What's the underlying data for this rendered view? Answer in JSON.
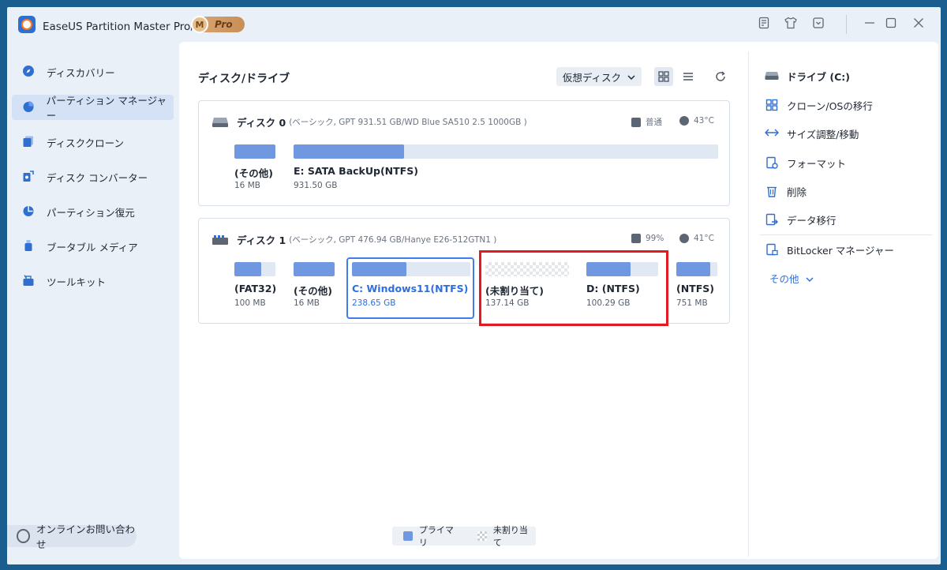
{
  "titlebar": {
    "title": "EaseUS Partition Master Pro版",
    "badge_letter": "M",
    "badge_text": "Pro",
    "icons": [
      "notes-icon",
      "shirt-icon",
      "download-icon",
      "minimize-icon",
      "maximize-icon",
      "close-icon"
    ]
  },
  "sidebar": {
    "items": [
      {
        "label": "ディスカバリー",
        "icon": "compass-icon",
        "active": false
      },
      {
        "label": "パーティション マネージャー",
        "icon": "pie-chart-icon",
        "active": true
      },
      {
        "label": "ディスククローン",
        "icon": "clone-icon",
        "active": false
      },
      {
        "label": "ディスク コンバーター",
        "icon": "converter-icon",
        "active": false
      },
      {
        "label": "パーティション復元",
        "icon": "recovery-icon",
        "active": false
      },
      {
        "label": "ブータブル メディア",
        "icon": "usb-icon",
        "active": false
      },
      {
        "label": "ツールキット",
        "icon": "toolkit-icon",
        "active": false
      }
    ],
    "contact": "オンラインお問い合わせ"
  },
  "main": {
    "title": "ディスク/ドライブ",
    "virtual_disk_label": "仮想ディスク",
    "disks": [
      {
        "name": "ディスク 0",
        "info": "(ベーシック, GPT 931.51 GB/WD Blue SA510 2.5 1000GB )",
        "stat1": "普通",
        "stat2": "43°C",
        "partitions": [
          {
            "label": "(その他)",
            "size": "16 MB",
            "usage": 1.0
          },
          {
            "label": "E: SATA BackUp(NTFS)",
            "size": "931.50 GB",
            "usage": 0.26
          }
        ]
      },
      {
        "name": "ディスク 1",
        "info": "(ベーシック, GPT 476.94 GB/Hanye E26-512GTN1 )",
        "stat1": "99%",
        "stat2": "41°C",
        "partitions": [
          {
            "label": "(FAT32)",
            "size": "100 MB",
            "usage": 0.66
          },
          {
            "label": "(その他)",
            "size": "16 MB",
            "usage": 1.0
          },
          {
            "label": "C: Windows11(NTFS)",
            "size": "238.65 GB",
            "usage": 0.46
          },
          {
            "label": "(未割り当て)",
            "size": "137.14 GB",
            "usage": 0
          },
          {
            "label": "D: (NTFS)",
            "size": "100.29 GB",
            "usage": 0.61
          },
          {
            "label": "(NTFS)",
            "size": "751 MB",
            "usage": 0.82
          }
        ]
      }
    ],
    "legend": {
      "primary": "プライマリ",
      "unallocated": "未割り当て"
    }
  },
  "right_panel": {
    "drive": "ドライブ (C:)",
    "ops": [
      "クローン/OSの移行",
      "サイズ調整/移動",
      "フォーマット",
      "削除",
      "データ移行"
    ],
    "bitlocker": "BitLocker マネージャー",
    "more": "その他"
  },
  "colors": {
    "primary_bar": "#6f98e0",
    "accent": "#2c6fe0",
    "highlight": "#e01b24"
  }
}
